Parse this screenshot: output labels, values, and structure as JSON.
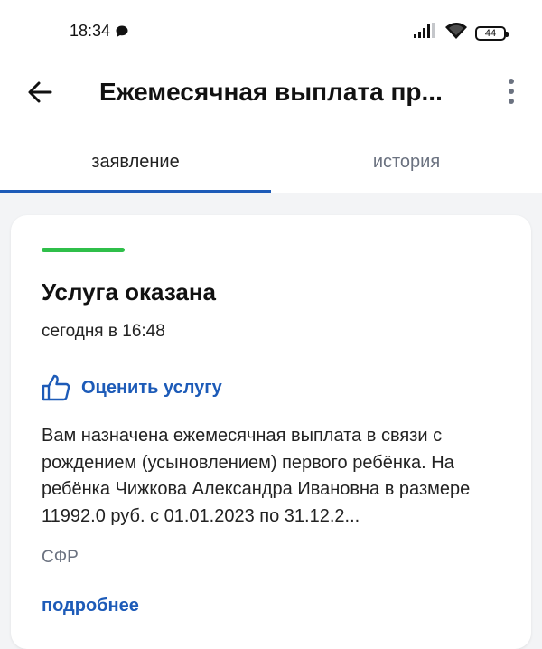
{
  "status_bar": {
    "time": "18:34",
    "battery": "44"
  },
  "app_bar": {
    "title": "Ежемесячная выплата пр..."
  },
  "tabs": [
    {
      "label": "заявление",
      "active": true
    },
    {
      "label": "история",
      "active": false
    }
  ],
  "card": {
    "status_title": "Услуга оказана",
    "status_date": "сегодня в 16:48",
    "rate_label": "Оценить услугу",
    "message": "Вам назначена ежемесячная выплата в связи с рождением (усыновлением) первого ребёнка. На ребёнка Чижкова Александра Ивановна в размере 11992.0 руб. с 01.01.2023 по 31.12.2...",
    "issuer": "СФР",
    "details_link": "подробнее"
  },
  "colors": {
    "accent_blue": "#1d5bb8",
    "success_green": "#2fbf4a",
    "muted_text": "#6b7280",
    "background": "#f3f4f6"
  },
  "icons": {
    "status_chat": "chat-bubble-icon",
    "signal": "signal-icon",
    "wifi": "wifi-icon",
    "battery": "battery-icon",
    "back": "arrow-left-icon",
    "more": "more-vertical-icon",
    "rate": "thumbs-up-icon"
  }
}
